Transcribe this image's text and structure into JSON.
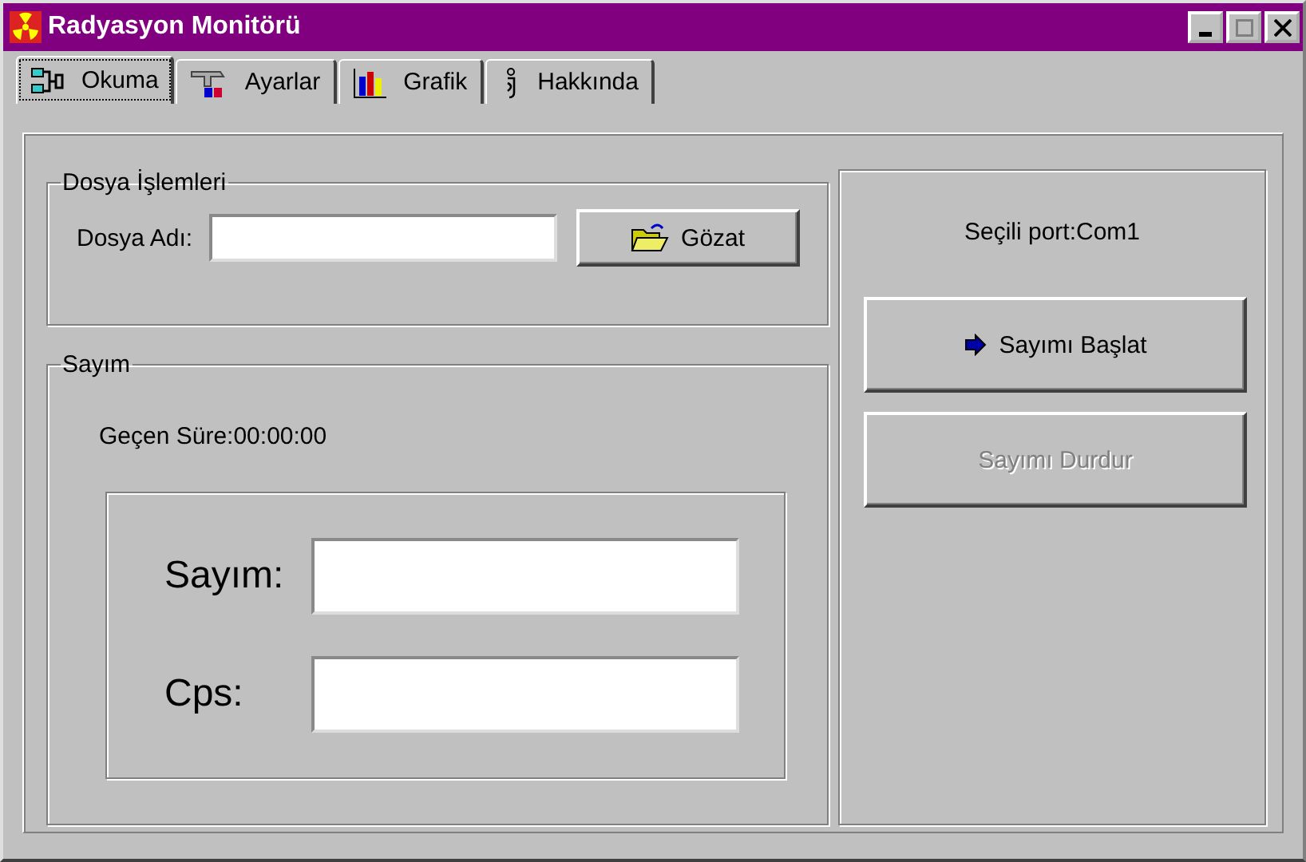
{
  "window": {
    "title": "Radyasyon Monitörü",
    "controls": [
      {
        "kind": "minimize",
        "disabled": false
      },
      {
        "kind": "maximize",
        "disabled": true
      },
      {
        "kind": "close",
        "disabled": false
      }
    ]
  },
  "tabs": [
    {
      "label": "Okuma",
      "selected": true
    },
    {
      "label": "Ayarlar",
      "selected": false
    },
    {
      "label": "Grafik",
      "selected": false
    },
    {
      "label": "Hakkında",
      "selected": false
    }
  ],
  "file_group": {
    "title": "Dosya İşlemleri",
    "label": "Dosya Adı:",
    "browse_button": {
      "label": "Gözat",
      "disabled": false
    }
  },
  "count_group": {
    "title": "Sayım",
    "elapsed": "Geçen Süre:00:00:00",
    "fields": [
      {
        "label": "Sayım:"
      },
      {
        "label": "Cps:"
      }
    ]
  },
  "port_panel": {
    "port": "Seçili port:Com1",
    "buttons": [
      {
        "label": "Sayımı Başlat",
        "disabled": false
      },
      {
        "label": "Sayımı Durdur",
        "disabled": true
      }
    ]
  }
}
